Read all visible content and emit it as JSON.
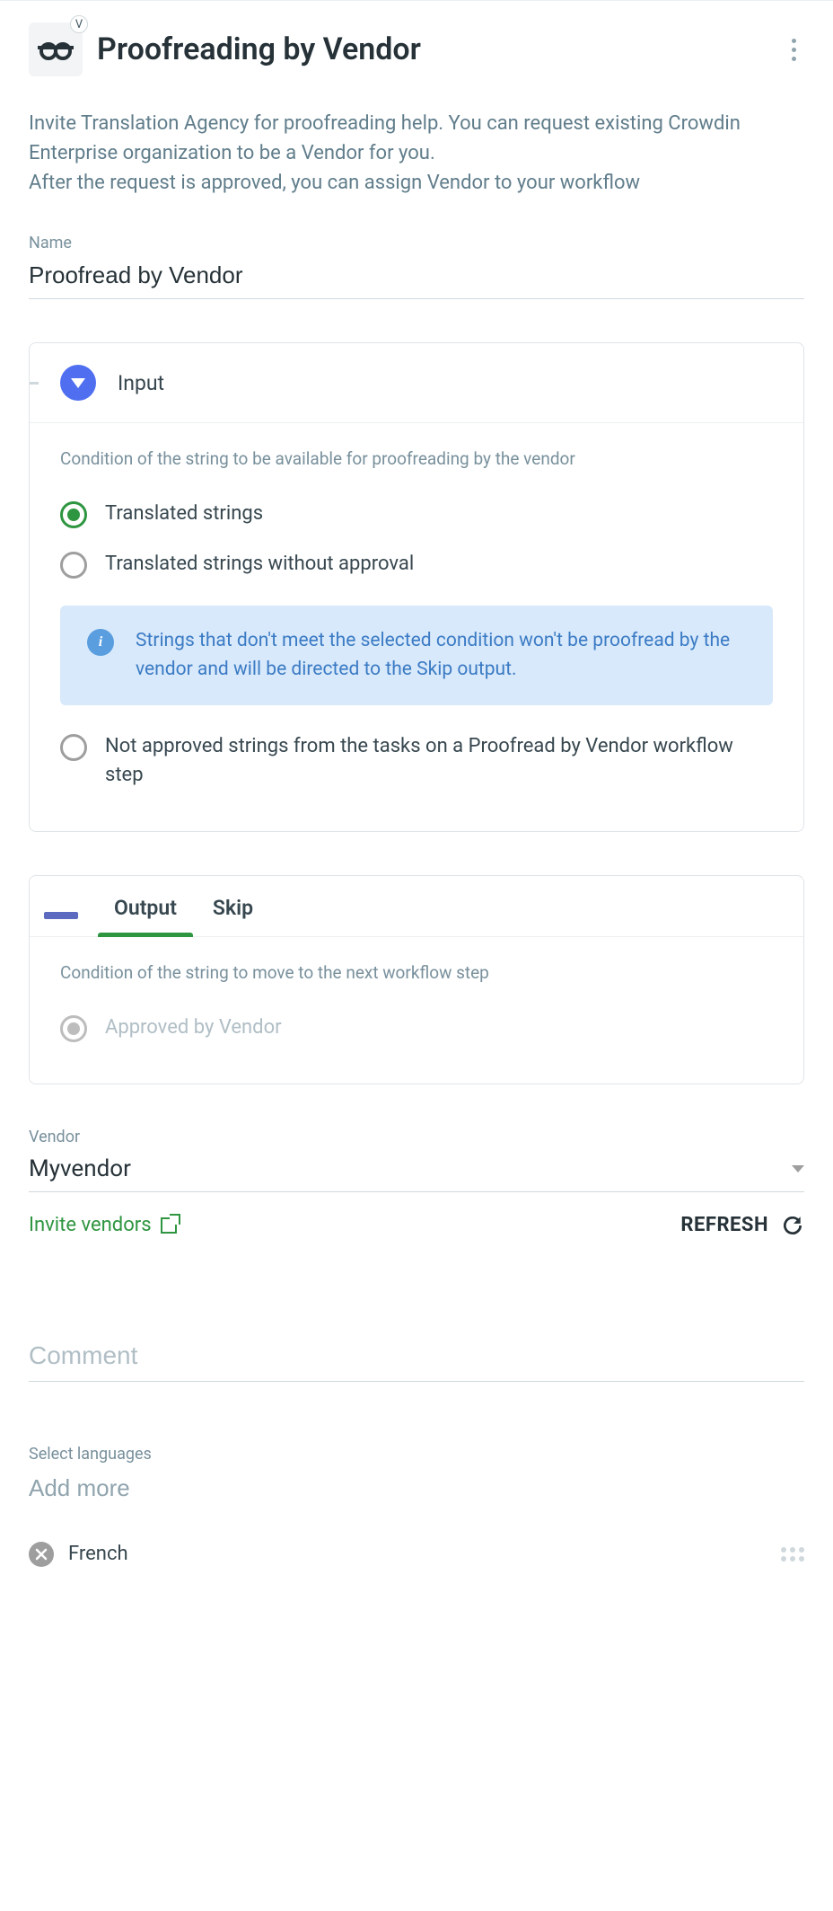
{
  "header": {
    "badge": "V",
    "title": "Proofreading by Vendor"
  },
  "description": "Invite Translation Agency for proofreading help. You can request existing Crowdin Enterprise organization to be a Vendor for you.\nAfter the request is approved, you can assign Vendor to your workflow",
  "name_field": {
    "label": "Name",
    "value": "Proofread by Vendor"
  },
  "input_panel": {
    "title": "Input",
    "condition_label": "Condition of the string to be available for proofreading by the vendor",
    "options": [
      "Translated strings",
      "Translated strings without approval",
      "Not approved strings from the tasks on a Proofread by Vendor workflow step"
    ],
    "info": "Strings that don't meet the selected condition won't be proofread by the vendor and will be directed to the Skip output."
  },
  "output_panel": {
    "tabs": [
      "Output",
      "Skip"
    ],
    "condition_label": "Condition of the string to move to the next workflow step",
    "option": "Approved by Vendor"
  },
  "vendor": {
    "label": "Vendor",
    "value": "Myvendor",
    "invite": "Invite vendors",
    "refresh": "REFRESH"
  },
  "comment": {
    "placeholder": "Comment"
  },
  "languages": {
    "label": "Select languages",
    "add_placeholder": "Add more",
    "items": [
      "French"
    ]
  }
}
